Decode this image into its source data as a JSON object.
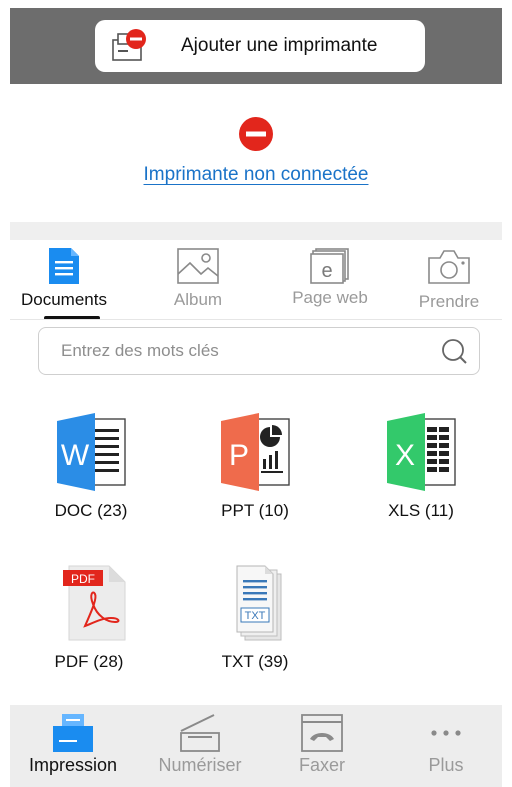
{
  "header": {
    "add_printer_label": "Ajouter une imprimante",
    "status_text": "Imprimante non connectée",
    "accent": "#1a73c8",
    "error_color": "#e2261c"
  },
  "tabs": [
    {
      "label": "Documents",
      "icon": "document-icon",
      "active": true
    },
    {
      "label": "Album",
      "icon": "image-icon",
      "active": false
    },
    {
      "label": "Page web",
      "icon": "web-page-icon",
      "active": false
    },
    {
      "label": "Prendre",
      "icon": "camera-icon",
      "active": false
    }
  ],
  "search": {
    "placeholder": "Entrez des mots clés"
  },
  "file_types": [
    {
      "label": "DOC (23)",
      "icon": "word-icon",
      "letter": "W"
    },
    {
      "label": "PPT (10)",
      "icon": "powerpoint-icon",
      "letter": "P"
    },
    {
      "label": "XLS (11)",
      "icon": "excel-icon",
      "letter": "X"
    },
    {
      "label": "PDF (28)",
      "icon": "pdf-icon",
      "badge": "PDF"
    },
    {
      "label": "TXT (39)",
      "icon": "txt-icon",
      "badge": "TXT"
    }
  ],
  "bottom_nav": [
    {
      "label": "Impression",
      "icon": "print-icon",
      "active": true
    },
    {
      "label": "Numériser",
      "icon": "scanner-icon",
      "active": false
    },
    {
      "label": "Faxer",
      "icon": "fax-icon",
      "active": false
    },
    {
      "label": "Plus",
      "icon": "more-icon",
      "active": false
    }
  ]
}
